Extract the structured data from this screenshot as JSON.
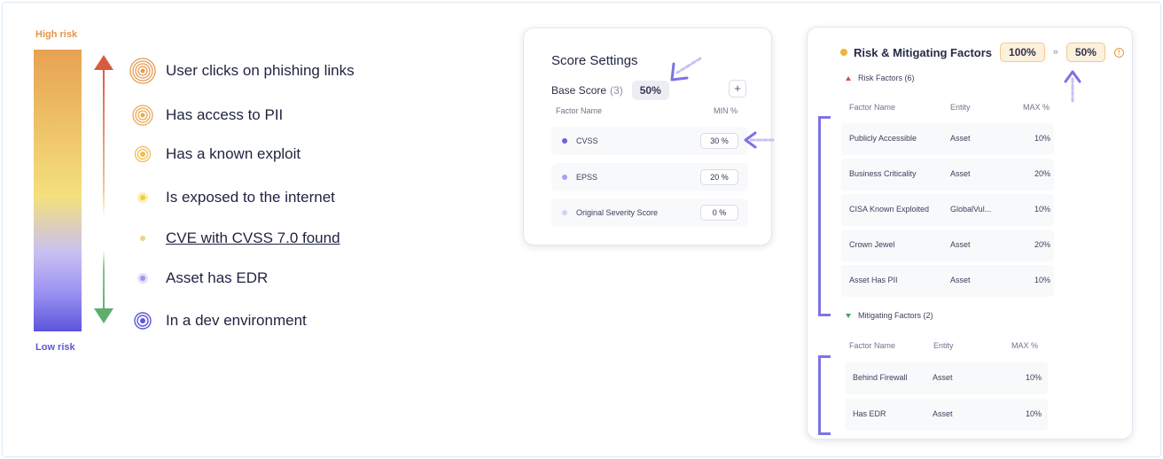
{
  "legend": {
    "high_label": "High risk",
    "low_label": "Low risk",
    "colors": {
      "high": "#e69446",
      "low": "#5b56d8",
      "up_arrow": "#d95b3f",
      "down_arrow": "#5fae6e"
    }
  },
  "factors": [
    {
      "label": "User clicks on phishing links",
      "icon": "concentric-circle-icon"
    },
    {
      "label": "Has access to PII",
      "icon": "concentric-circle-icon"
    },
    {
      "label": "Has a known exploit",
      "icon": "concentric-circle-icon"
    },
    {
      "label": "Is exposed to the internet",
      "icon": "circle-dot-icon"
    },
    {
      "label": "CVE with CVSS 7.0 found",
      "icon": "dot-icon"
    },
    {
      "label": "Asset has EDR",
      "icon": "circle-dot-icon"
    },
    {
      "label": "In a dev environment",
      "icon": "concentric-circle-icon"
    }
  ],
  "score_settings": {
    "title": "Score Settings",
    "base_label": "Base Score",
    "base_count": "(3)",
    "base_pct": "50%",
    "add_label": "+",
    "col_factor": "Factor Name",
    "col_min": "MIN %",
    "rows": [
      {
        "name": "CVSS",
        "pct": "30 %",
        "color": "#6b63dd"
      },
      {
        "name": "EPSS",
        "pct": "20 %",
        "color": "#a79ff0"
      },
      {
        "name": "Original Severity Score",
        "pct": "0 %",
        "color": "#d3cff8"
      }
    ]
  },
  "risk_card": {
    "title": "Risk & Mitigating Factors",
    "pct_before": "100%",
    "chevron": "»",
    "pct_after": "50%",
    "info_icon": "info-icon",
    "risk_section": "Risk Factors (6)",
    "mitigating_section": "Mitigating Factors (2)",
    "col_factor": "Factor Name",
    "col_entity": "Entity",
    "col_max": "MAX %",
    "risk_rows": [
      {
        "name": "Publicly Accessible",
        "entity": "Asset",
        "max": "10%"
      },
      {
        "name": "Business Criticality",
        "entity": "Asset",
        "max": "20%"
      },
      {
        "name": "CISA Known Exploited",
        "entity": "GlobalVul...",
        "max": "10%"
      },
      {
        "name": "Crown Jewel",
        "entity": "Asset",
        "max": "20%"
      },
      {
        "name": "Asset Has PII",
        "entity": "Asset",
        "max": "10%"
      }
    ],
    "mitigating_rows": [
      {
        "name": "Behind Firewall",
        "entity": "Asset",
        "max": "10%"
      },
      {
        "name": "Has EDR",
        "entity": "Asset",
        "max": "10%"
      }
    ]
  }
}
